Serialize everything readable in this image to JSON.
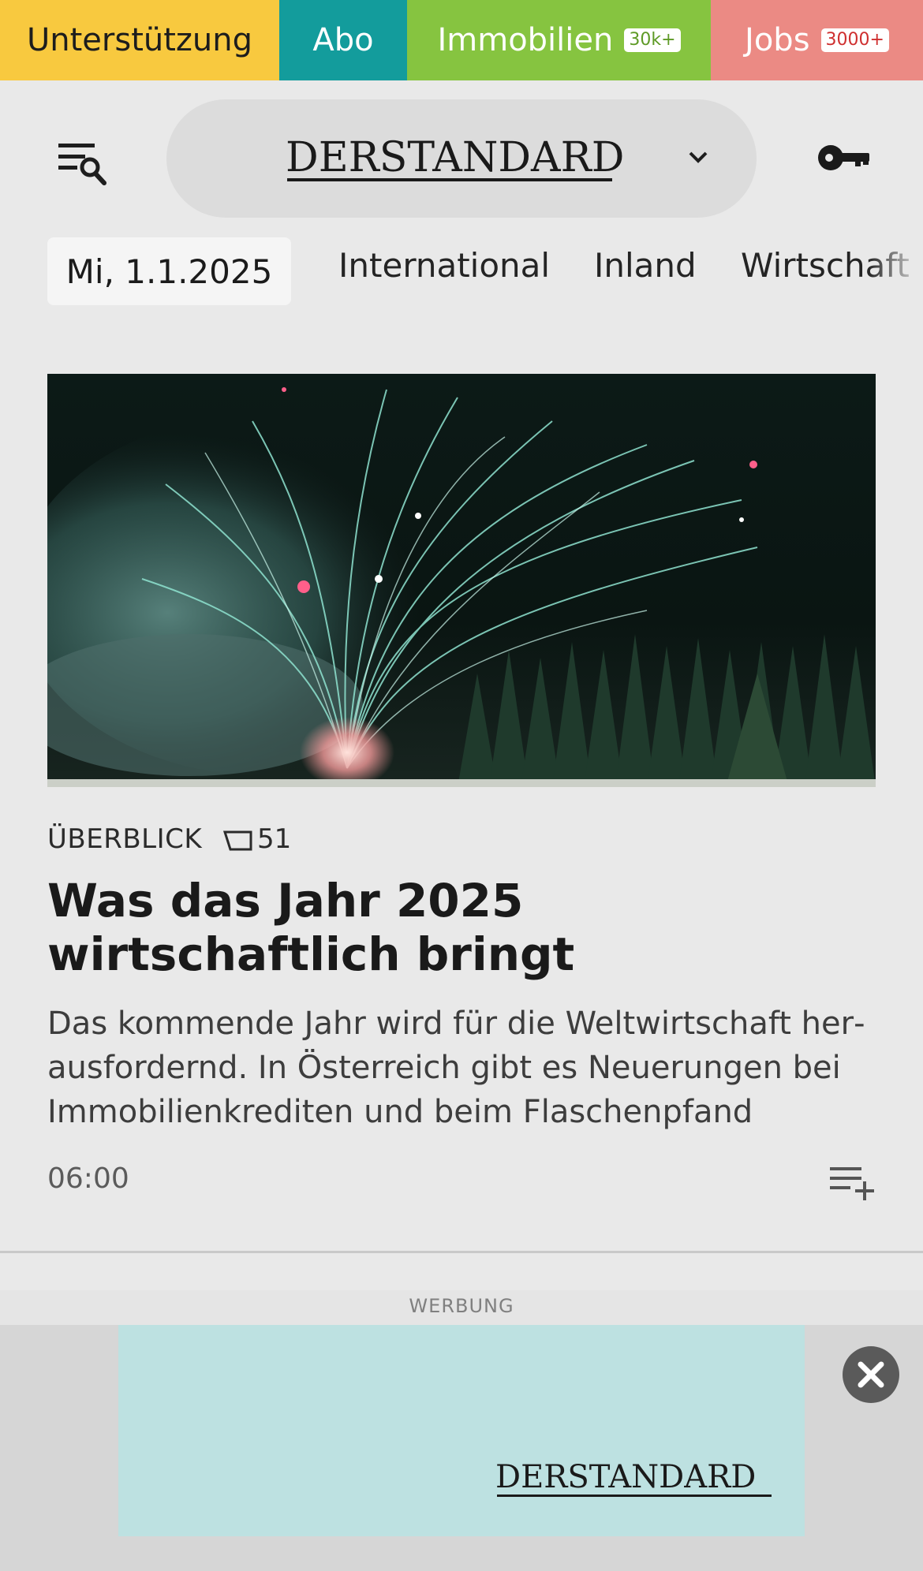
{
  "top_bar": {
    "support_label": "Unterstützung",
    "abo_label": "Abo",
    "immobilien_label": "Immobilien",
    "immobilien_badge": "30k+",
    "jobs_label": "Jobs",
    "jobs_badge": "3000+",
    "colors": {
      "support": "#f8c93f",
      "abo": "#139c9c",
      "immobilien": "#86c440",
      "jobs": "#eb8a84"
    }
  },
  "header": {
    "logo_text": "DERSTANDARD",
    "menu_icon": "menu-search-icon",
    "dropdown_icon": "chevron-down-icon",
    "login_icon": "key-icon"
  },
  "nav": {
    "date": "Mi, 1.1.2025",
    "items": [
      "International",
      "Inland",
      "Wirtschaft"
    ]
  },
  "article": {
    "kicker": "ÜBERBLICK",
    "comment_count": "51",
    "headline": "Was das Jahr 2025 wirtschaftlich bringt",
    "teaser": "Das kommende Jahr wird für die Weltwirtschaft her­ausfordernd. In Österreich gibt es Neuerungen bei Immobilienkrediten und beim Flaschenpfand",
    "time": "06:00",
    "image_subject": "fireworks over a forest at night"
  },
  "ad": {
    "label": "WERBUNG",
    "logo_text": "DERSTANDARD",
    "close_icon": "close-icon"
  }
}
